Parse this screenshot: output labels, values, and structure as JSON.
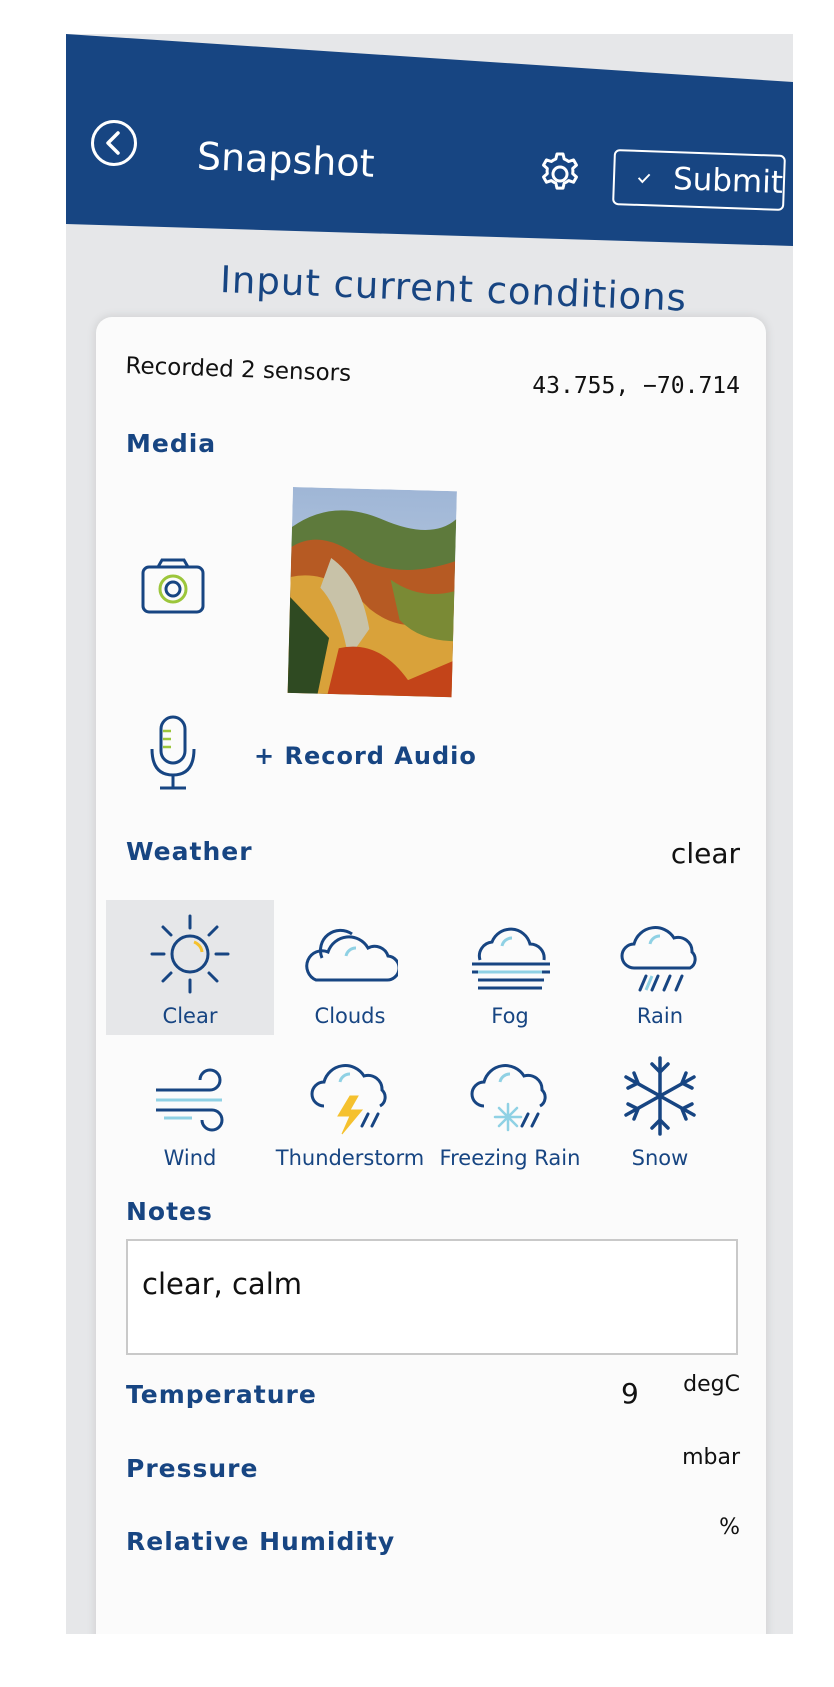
{
  "header": {
    "title": "Snapshot",
    "submit_label": "Submit",
    "back_icon": "chevron-left-icon",
    "settings_icon": "gear-icon"
  },
  "subtitle": "Input current conditions",
  "status": {
    "recorded": "Recorded 2 sensors",
    "coords": "43.755, −70.714"
  },
  "media": {
    "label": "Media",
    "record_audio": "+ Record Audio"
  },
  "weather": {
    "label": "Weather",
    "selected_value": "clear",
    "options": [
      {
        "label": "Clear",
        "icon": "sun-icon",
        "selected": true
      },
      {
        "label": "Clouds",
        "icon": "cloud-icon"
      },
      {
        "label": "Fog",
        "icon": "fog-icon"
      },
      {
        "label": "Rain",
        "icon": "rain-icon"
      },
      {
        "label": "Wind",
        "icon": "wind-icon"
      },
      {
        "label": "Thunderstorm",
        "icon": "thunderstorm-icon"
      },
      {
        "label": "Freezing Rain",
        "icon": "freezing-rain-icon"
      },
      {
        "label": "Snow",
        "icon": "snowflake-icon"
      }
    ]
  },
  "notes": {
    "label": "Notes",
    "value": "clear, calm"
  },
  "temperature": {
    "label": "Temperature",
    "value": "9",
    "unit": "degC"
  },
  "pressure": {
    "label": "Pressure",
    "unit": "mbar"
  },
  "humidity": {
    "label": "Relative Humidity",
    "unit": "%"
  },
  "colors": {
    "primary": "#174582",
    "accent_blue": "#8fd1e4",
    "accent_yellow": "#f5c12e",
    "accent_green": "#9cc63b"
  }
}
